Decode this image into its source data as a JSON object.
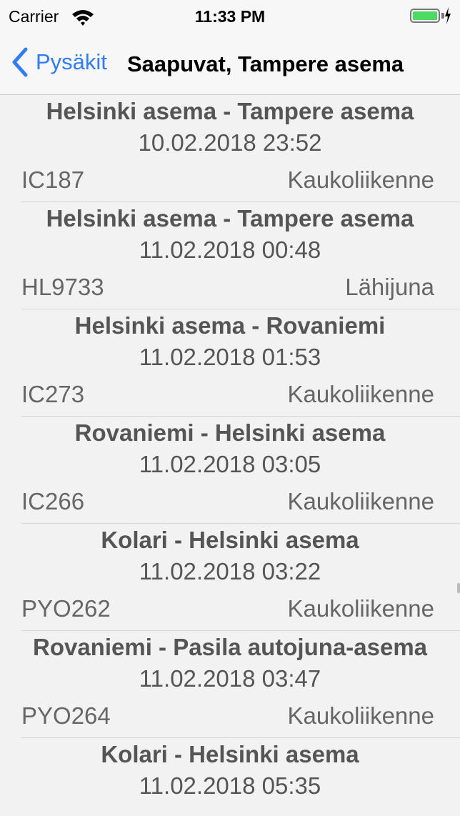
{
  "status": {
    "carrier": "Carrier",
    "time": "11:33 PM"
  },
  "nav": {
    "back_label": "Pysäkit",
    "title": "Saapuvat, Tampere asema"
  },
  "trains": [
    {
      "route": "Helsinki asema - Tampere asema",
      "datetime": "10.02.2018 23:52",
      "id": "IC187",
      "type": "Kaukoliikenne"
    },
    {
      "route": "Helsinki asema - Tampere asema",
      "datetime": "11.02.2018 00:48",
      "id": "HL9733",
      "type": "Lähijuna"
    },
    {
      "route": "Helsinki asema - Rovaniemi",
      "datetime": "11.02.2018 01:53",
      "id": "IC273",
      "type": "Kaukoliikenne"
    },
    {
      "route": "Rovaniemi - Helsinki asema",
      "datetime": "11.02.2018 03:05",
      "id": "IC266",
      "type": "Kaukoliikenne"
    },
    {
      "route": "Kolari - Helsinki asema",
      "datetime": "11.02.2018 03:22",
      "id": "PYO262",
      "type": "Kaukoliikenne"
    },
    {
      "route": "Rovaniemi - Pasila autojuna-asema",
      "datetime": "11.02.2018 03:47",
      "id": "PYO264",
      "type": "Kaukoliikenne"
    },
    {
      "route": "Kolari - Helsinki asema",
      "datetime": "11.02.2018 05:35",
      "id": "",
      "type": ""
    }
  ],
  "colors": {
    "accent": "#2f7cf6",
    "battery": "#4cd964",
    "text": "#555555",
    "background": "#f2f2f2"
  },
  "icons": {
    "signal": "wifi-icon",
    "battery": "battery-icon",
    "charging": "bolt-icon",
    "back": "chevron-left-icon"
  }
}
